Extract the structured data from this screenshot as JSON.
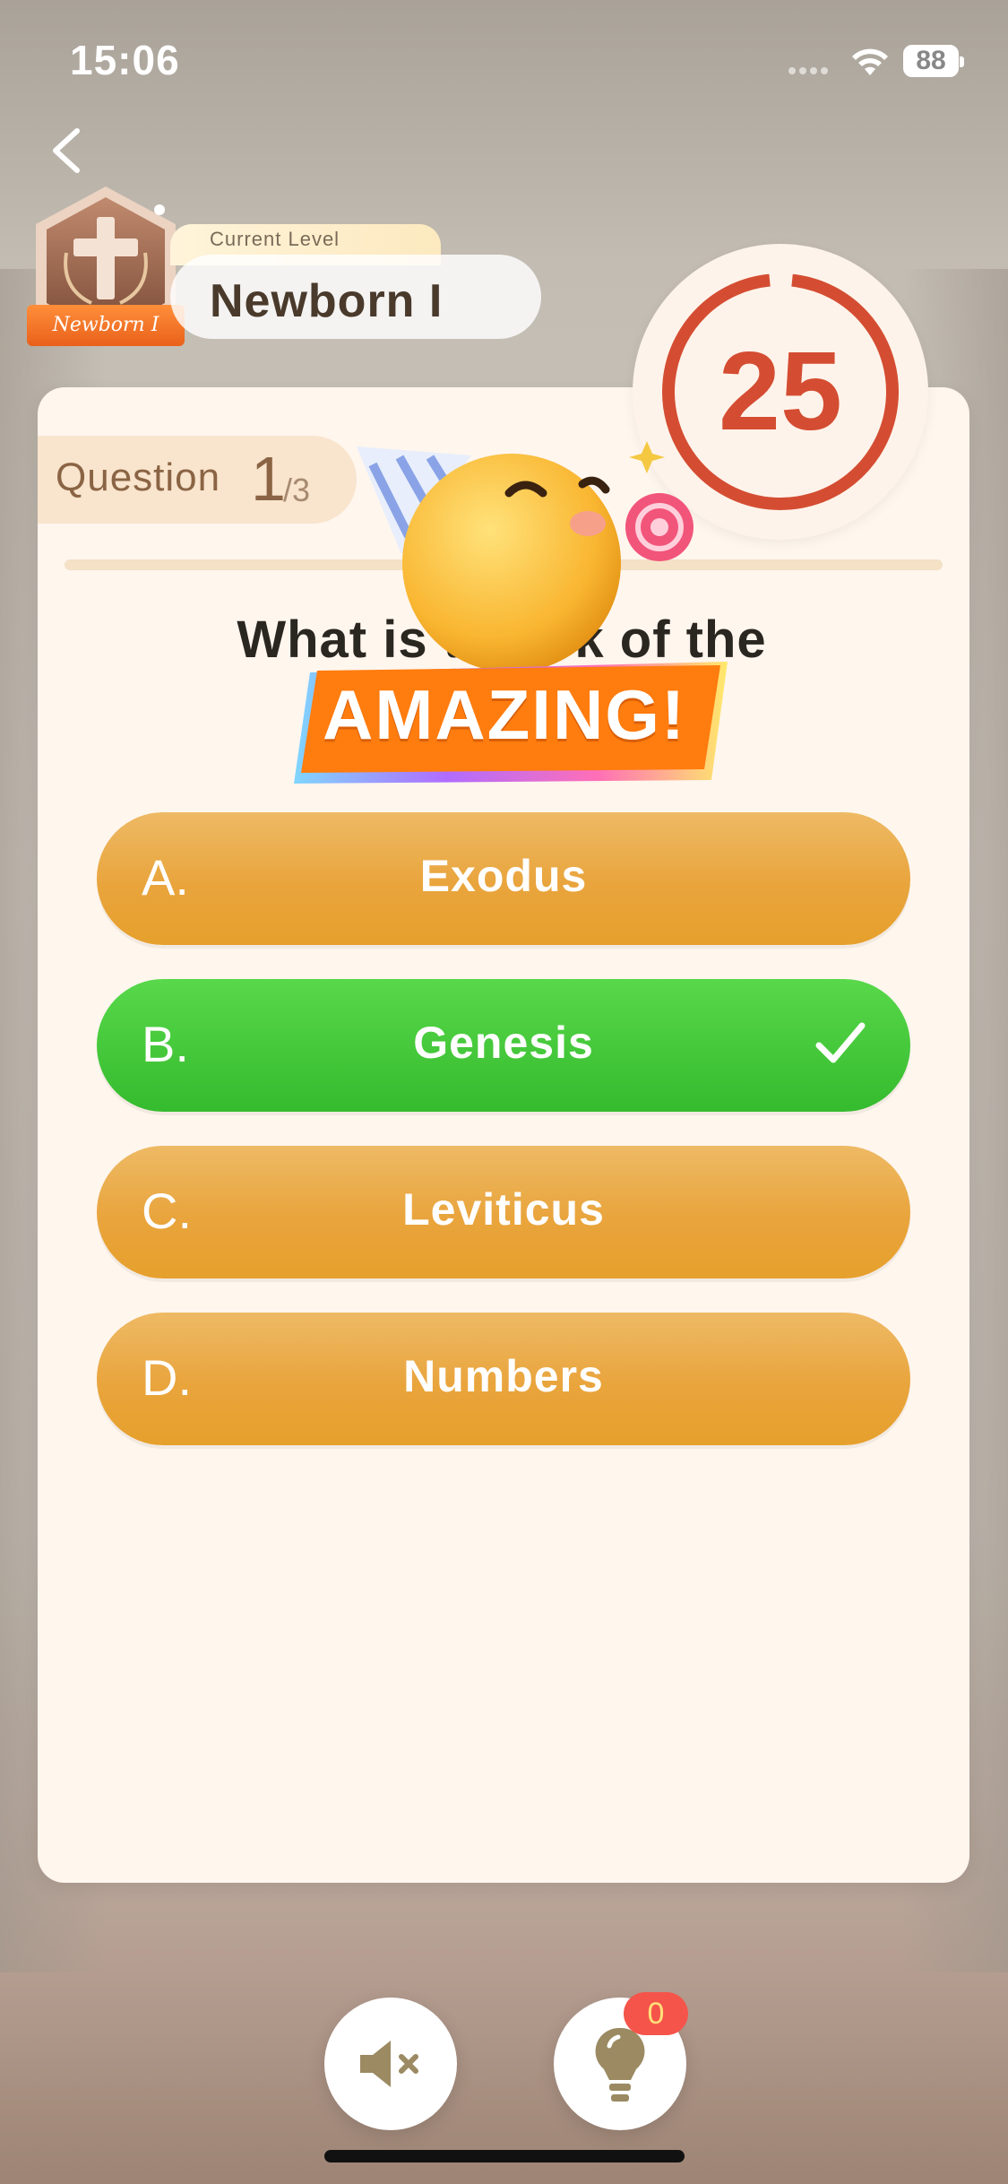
{
  "status_bar": {
    "time": "15:06",
    "battery": "88"
  },
  "level": {
    "badge_label": "Newborn I",
    "caption": "Current Level",
    "name": "Newborn I"
  },
  "question": {
    "label": "Question",
    "current": "1",
    "total": "/3",
    "text": "What is th        ook of the"
  },
  "timer": {
    "seconds": "25",
    "colors": {
      "ring": "#d44d32"
    }
  },
  "celebration": {
    "text": "AMAZING!"
  },
  "options": [
    {
      "letter": "A.",
      "text": "Exodus",
      "state": "default"
    },
    {
      "letter": "B.",
      "text": "Genesis",
      "state": "correct"
    },
    {
      "letter": "C.",
      "text": "Leviticus",
      "state": "default"
    },
    {
      "letter": "D.",
      "text": "Numbers",
      "state": "default"
    }
  ],
  "controls": {
    "sound_icon": "speaker-muted-icon",
    "hint_icon": "lightbulb-icon",
    "hint_count": "0"
  },
  "colors": {
    "option_default": "#e9a43c",
    "option_correct": "#3fc536",
    "timer": "#d44d32",
    "card_bg": "#fff6ee"
  }
}
